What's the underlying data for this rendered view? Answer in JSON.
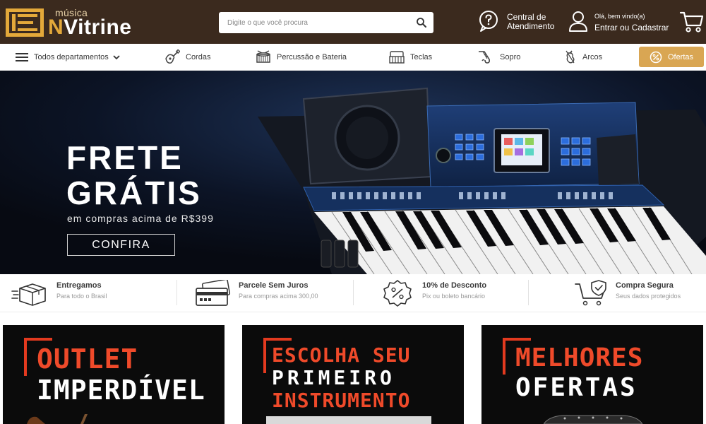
{
  "header": {
    "logo_small": "música",
    "logo_big_initial": "N",
    "logo_big_rest": "Vitrine",
    "search_placeholder": "Digite o que você procura",
    "help_line1": "Central de",
    "help_line2": "Atendimento",
    "account_greeting": "Olá, bem vindo(a)",
    "account_link": "Entrar ou Cadastrar",
    "icons": [
      "search-icon",
      "chat-help-icon",
      "user-icon",
      "cart-icon"
    ]
  },
  "nav": {
    "items": [
      {
        "label": "Todos departamentos",
        "icon": "hamburger-icon"
      },
      {
        "label": "Cordas",
        "icon": "guitar-icon"
      },
      {
        "label": "Percussão e Bateria",
        "icon": "drum-icon"
      },
      {
        "label": "Teclas",
        "icon": "keyboard-icon"
      },
      {
        "label": "Sopro",
        "icon": "saxophone-icon"
      },
      {
        "label": "Arcos",
        "icon": "violin-icon"
      }
    ],
    "offers_label": "Ofertas"
  },
  "hero": {
    "title_line1": "FRETE",
    "title_line2": "GRÁTIS",
    "subtitle": "em compras acima de R$399",
    "cta": "CONFIRA"
  },
  "benefits": [
    {
      "title": "Entregamos",
      "subtitle": "Para todo o Brasil",
      "icon": "delivery-box-icon"
    },
    {
      "title": "Parcele Sem Juros",
      "subtitle": "Para compras acima 300,00",
      "icon": "credit-card-icon"
    },
    {
      "title": "10% de Desconto",
      "subtitle": "Pix ou boleto bancário",
      "icon": "percent-badge-icon"
    },
    {
      "title": "Compra Segura",
      "subtitle": "Seus dados protegidos",
      "icon": "secure-cart-icon"
    }
  ],
  "promos": [
    {
      "line1": "OUTLET",
      "line2": "IMPERDÍVEL"
    },
    {
      "line1": "ESCOLHA SEU",
      "line2": "PRIMEIRO",
      "line3": "INSTRUMENTO"
    },
    {
      "line1": "MELHORES",
      "line2": "OFERTAS"
    }
  ],
  "colors": {
    "header_bg": "#3b2a1e",
    "accent_gold": "#d9a653",
    "promo_red": "#ef4a2a",
    "hero_bg": "#0a0f1c"
  }
}
